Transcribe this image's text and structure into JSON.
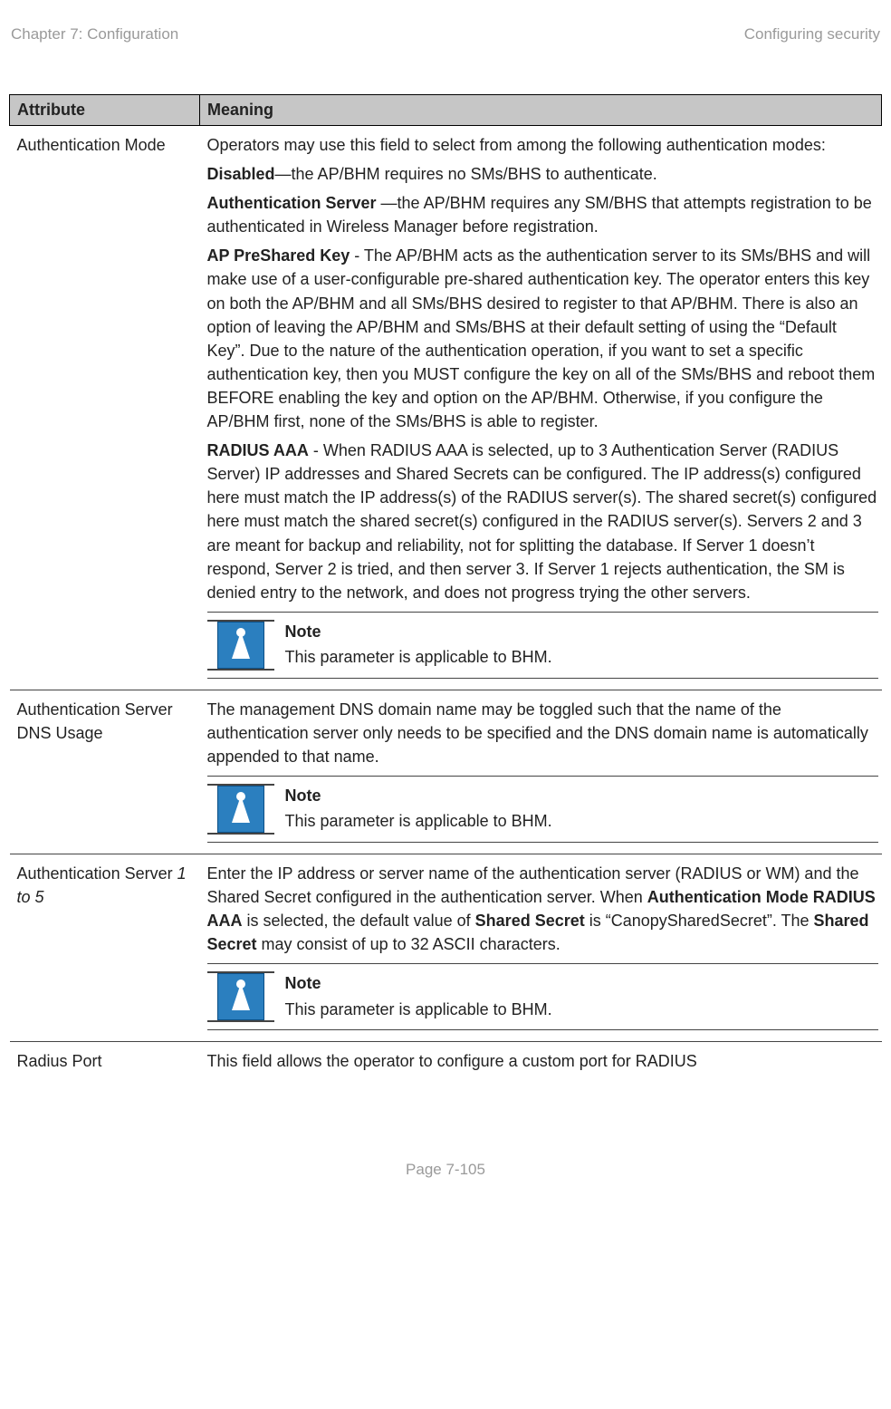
{
  "header": {
    "chapter": "Chapter 7:  Configuration",
    "section": "Configuring security"
  },
  "table": {
    "col_attribute": "Attribute",
    "col_meaning": "Meaning",
    "rows": [
      {
        "attr": "Authentication Mode",
        "intro": "Operators may use this field to select from among the following authentication modes:",
        "disabled_b": "Disabled",
        "disabled_t": "—the AP/BHM requires no SMs/BHS to authenticate.",
        "authsrv_b": "Authentication Server ",
        "authsrv_t": "—the AP/BHM requires any SM/BHS that attempts registration to be authenticated in Wireless Manager before registration.",
        "appsk_b": "AP PreShared Key",
        "appsk_t": " - The AP/BHM acts as the authentication server to its SMs/BHS and will make use of a user-configurable pre-shared authentication key.  The operator enters this key on both the AP/BHM and all SMs/BHS desired to register to that AP/BHM.  There is also an option of leaving the AP/BHM and SMs/BHS at their default setting of using the “Default Key”.  Due to the nature of the authentication operation, if you want to set a specific authentication key, then you MUST configure the key on all of the SMs/BHS and reboot them BEFORE enabling the key and option on the AP/BHM.  Otherwise, if you configure the AP/BHM first, none of the SMs/BHS is able to register.",
        "radius_b": "RADIUS AAA",
        "radius_t": " - When RADIUS AAA is selected, up to 3 Authentication Server (RADIUS Server) IP addresses and Shared Secrets can be configured. The IP address(s) configured here must match the IP address(s) of the RADIUS server(s). The shared secret(s) configured here must match the shared secret(s) configured in the RADIUS server(s). Servers 2 and 3 are meant for backup and reliability, not for splitting the database. If Server 1 doesn’t respond, Server 2 is tried, and then server 3. If Server 1 rejects authentication, the SM is denied entry to the network, and does not progress trying the other servers.",
        "note_title": "Note",
        "note_body": "This parameter is applicable to BHM."
      },
      {
        "attr": "Authentication Server DNS Usage",
        "body": "The management DNS domain name may be toggled such that the name of the authentication server only needs to be specified and the DNS domain name is automatically appended to that name.",
        "note_title": "Note",
        "note_body": "This parameter is applicable to BHM."
      },
      {
        "attr_a": "Authentication Server ",
        "attr_b_italic": "1 to 5",
        "body_a": "Enter the IP address or server name of the authentication server (RADIUS or WM) and the Shared Secret configured in the authentication server.  When ",
        "body_b_bold": "Authentication Mode RADIUS AAA",
        "body_c": " is selected, the default value of ",
        "body_d_bold": "Shared Secret",
        "body_e": " is “CanopySharedSecret”.  The ",
        "body_f_bold": "Shared Secret",
        "body_g": " may consist of up to 32 ASCII characters.",
        "note_title": "Note",
        "note_body": "This parameter is applicable to BHM."
      },
      {
        "attr": "Radius Port",
        "body": "This field allows the operator to configure a custom port for RADIUS"
      }
    ]
  },
  "footer": {
    "page": "Page 7-105"
  }
}
